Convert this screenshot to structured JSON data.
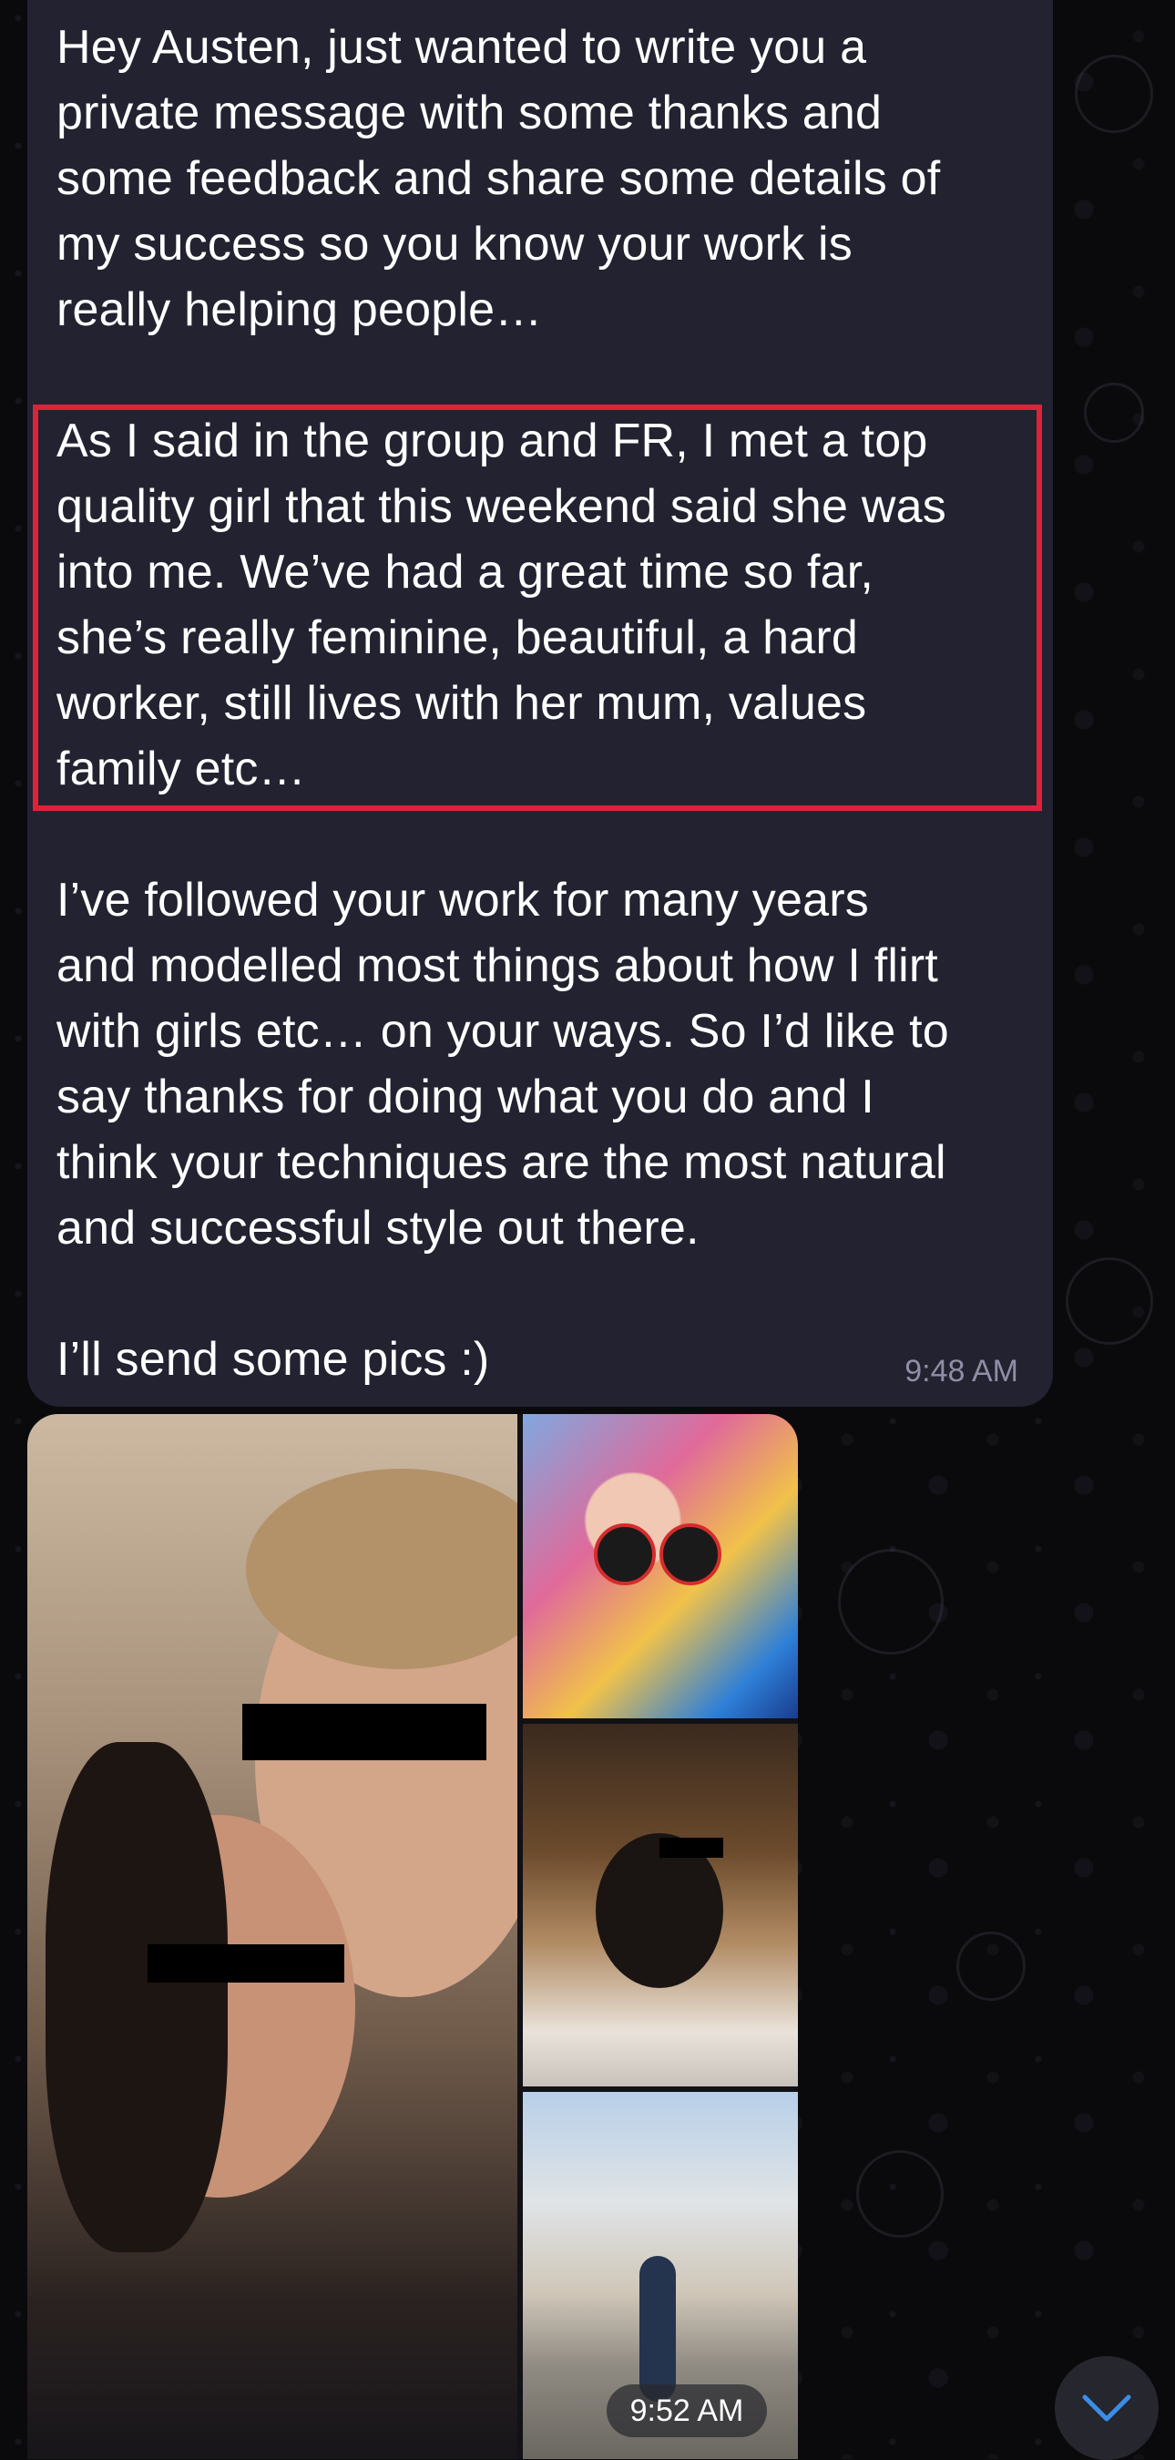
{
  "message": {
    "paragraph_1": "Hey Austen, just wanted to write you a\nprivate message with some thanks and\nsome feedback and share some details of\nmy success so you know your work is\nreally helping people…",
    "paragraph_2": "As I said in the group and FR, I met a top\nquality girl that this weekend said she was\ninto me. We’ve had a great time so far,\nshe’s really feminine, beautiful, a hard\nworker, still lives with her mum, values\nfamily etc…",
    "paragraph_3": "I’ve followed your work for many years\nand modelled most things about how I flirt\nwith girls etc… on your ways. So I’d like to\nsay thanks for doing what you do and I\nthink your techniques are the most natural\nand successful style out there.",
    "paragraph_4": "I’ll send some pics :)",
    "time": "9:48 AM",
    "highlight_color": "#e0213a"
  },
  "album": {
    "time": "9:52 AM",
    "photos": [
      {
        "name": "couple-photo"
      },
      {
        "name": "mural-photo"
      },
      {
        "name": "cafe-photo"
      },
      {
        "name": "street-photo"
      }
    ]
  },
  "controls": {
    "scroll_down_icon": "chevron-down-icon",
    "accent": "#3a8ee6"
  }
}
